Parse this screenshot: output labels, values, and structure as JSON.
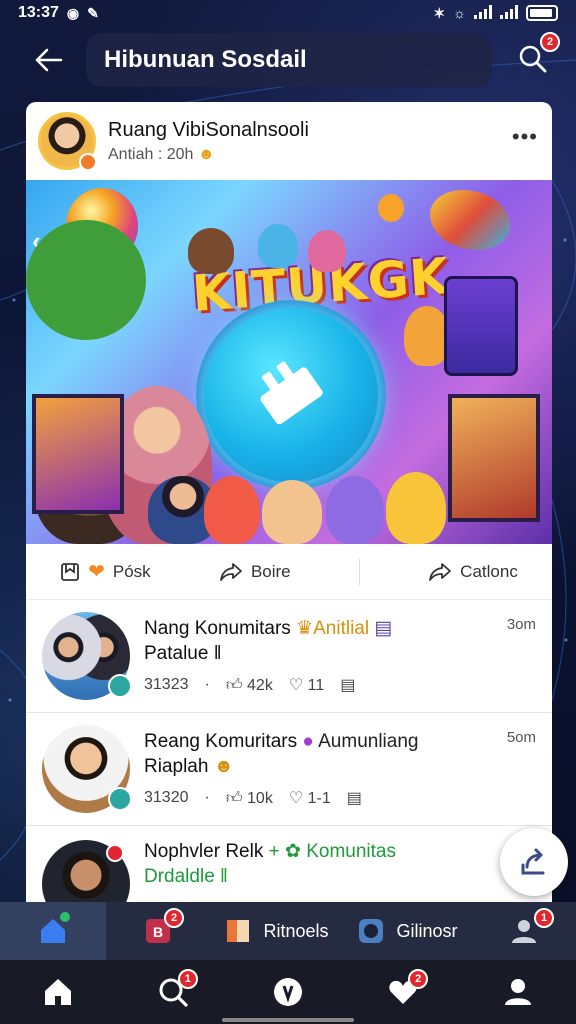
{
  "status_bar": {
    "time": "13:37",
    "icons": [
      "notification-icon",
      "app-icon",
      "bluetooth-icon",
      "wifi-icon",
      "signal-icon",
      "battery-icon"
    ]
  },
  "header": {
    "title": "Hibunuan Sosdail",
    "search_badge": "2"
  },
  "post": {
    "page_name": "Ruang VibiSonalnsooli",
    "time_meta": "Antiah : 20h",
    "hero_title": "KITUKGK",
    "actions": [
      {
        "label": "Pósk",
        "icon": "heart-icon"
      },
      {
        "label": "Boire",
        "icon": "share-icon"
      },
      {
        "label": "Catlonc",
        "icon": "forward-icon"
      }
    ]
  },
  "list": [
    {
      "title": "Nang Konumitars",
      "highlight": "Anitlial",
      "subtitle": "Patalue",
      "time": "3om",
      "stats": {
        "views": "31323",
        "likes": "42k",
        "comments": "11"
      }
    },
    {
      "title": "Reang Komuritars",
      "highlight": "Aumunliang",
      "subtitle": "Riaplah",
      "time": "5om",
      "stats": {
        "views": "31320",
        "likes": "10k",
        "comments": "1-1"
      }
    },
    {
      "title": "Nophvler Relk",
      "highlight": "Komunitas",
      "subtitle": "Drdaldle",
      "time": "",
      "stats": {}
    }
  ],
  "tabbar": [
    {
      "label": "",
      "icon": "home-tab-icon",
      "badge": ""
    },
    {
      "label": "",
      "icon": "video-tab-icon",
      "badge": "2"
    },
    {
      "label": "Ritnoels",
      "icon": "book-icon",
      "badge": ""
    },
    {
      "label": "Gilinosr",
      "icon": "chat-bubble-icon",
      "badge": ""
    },
    {
      "label": "",
      "icon": "people-icon",
      "badge": "1"
    }
  ],
  "bottomnav": [
    {
      "icon": "home-icon",
      "badge": ""
    },
    {
      "icon": "search-icon",
      "badge": "1"
    },
    {
      "icon": "compass-icon",
      "badge": ""
    },
    {
      "icon": "heart-icon",
      "badge": "2"
    },
    {
      "icon": "profile-icon",
      "badge": ""
    }
  ],
  "colors": {
    "background": "#0d1330",
    "card": "#ffffff",
    "badge": "#e3262d",
    "tabbar": "#252b40",
    "bottomnav": "#181b25"
  }
}
